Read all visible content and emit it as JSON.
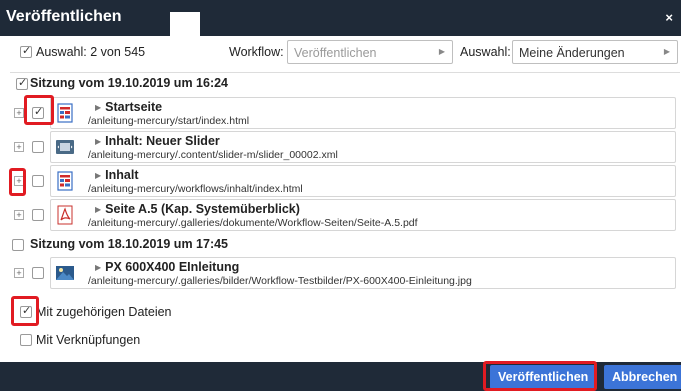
{
  "dialog": {
    "title": "Veröffentlichen",
    "close_symbol": "×"
  },
  "toolbar": {
    "selection_text": "Auswahl: 2 von 545",
    "workflow_label": "Workflow:",
    "workflow_value": "Veröffentlichen",
    "filter_label": "Auswahl:",
    "filter_value": "Meine Änderungen"
  },
  "sessions": [
    {
      "label": "Sitzung vom 19.10.2019 um 16:24",
      "items": [
        {
          "name": "Startseite",
          "path": "/anleitung-mercury/start/index.html",
          "checked": true,
          "icon": "page-icon"
        },
        {
          "name": "Inhalt: Neuer Slider",
          "path": "/anleitung-mercury/.content/slider-m/slider_00002.xml",
          "checked": false,
          "icon": "slider-icon"
        },
        {
          "name": "Inhalt",
          "path": "/anleitung-mercury/workflows/inhalt/index.html",
          "checked": false,
          "icon": "page-icon"
        },
        {
          "name": "Seite A.5 (Kap. Systemüberblick)",
          "path": "/anleitung-mercury/.galleries/dokumente/Workflow-Seiten/Seite-A.5.pdf",
          "checked": false,
          "icon": "pdf-icon"
        }
      ]
    },
    {
      "label": "Sitzung vom 18.10.2019 um 17:45",
      "items": [
        {
          "name": "PX 600X400 EInleitung",
          "path": "/anleitung-mercury/.galleries/bilder/Workflow-Testbilder/PX-600X400-Einleitung.jpg",
          "checked": false,
          "icon": "image-icon"
        }
      ]
    }
  ],
  "options": {
    "related_files": "Mit zugehörigen Dateien",
    "links": "Mit Verknüpfungen"
  },
  "buttons": {
    "publish": "Veröffentlichen",
    "cancel": "Abbrechen"
  },
  "colors": {
    "titlebar": "#1f2a38",
    "button": "#3c74d8",
    "highlight": "#e11b22"
  }
}
